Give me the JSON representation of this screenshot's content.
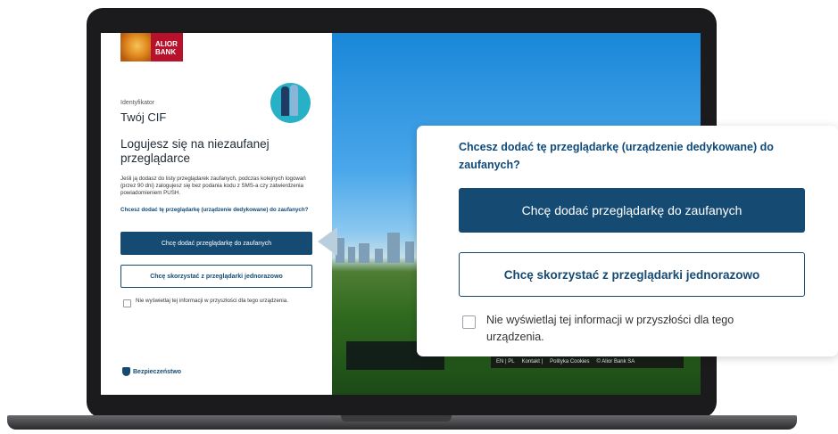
{
  "bank": {
    "logo_text": "ALIOR BANK"
  },
  "login": {
    "identifier_label": "Identyfikator",
    "identifier_value": "Twój CIF",
    "heading": "Logujesz się na niezaufanej przeglądarce",
    "description": "Jeśli ją dodasz do listy przeglądarek zaufanych, podczas kolejnych logowań (przez 90 dni) zalogujesz się bez podania kodu z SMS-a czy zatwierdzenia powiadomieniem PUSH.",
    "question": "Chcesz dodać tę przeglądarkę (urządzenie dedykowane) do zaufanych?",
    "add_trusted_label": "Chcę dodać przeglądarkę do zaufanych",
    "use_once_label": "Chcę skorzystać z przeglądarki jednorazowo",
    "dont_show_label": "Nie wyświetlaj tej informacji w przyszłości dla tego urządzenia.",
    "security_label": "Bezpieczeństwo"
  },
  "footer": {
    "lang": "EN | PL",
    "contact": "Kontakt |",
    "cookies": "Polityka Cookies",
    "copyright": "© Alior Bank SA"
  },
  "callout": {
    "question": "Chcesz dodać tę przeglądarkę (urządzenie dedykowane) do zaufanych?",
    "add_trusted_label": "Chcę dodać przeglądarkę do zaufanych",
    "use_once_label": "Chcę skorzystać z przeglądarki jednorazowo",
    "dont_show_label": "Nie wyświetlaj tej informacji w przyszłości dla tego urządzenia."
  },
  "colors": {
    "primary": "#154b73",
    "accent_text": "#0e4a7a",
    "brand_red": "#b8112b"
  }
}
